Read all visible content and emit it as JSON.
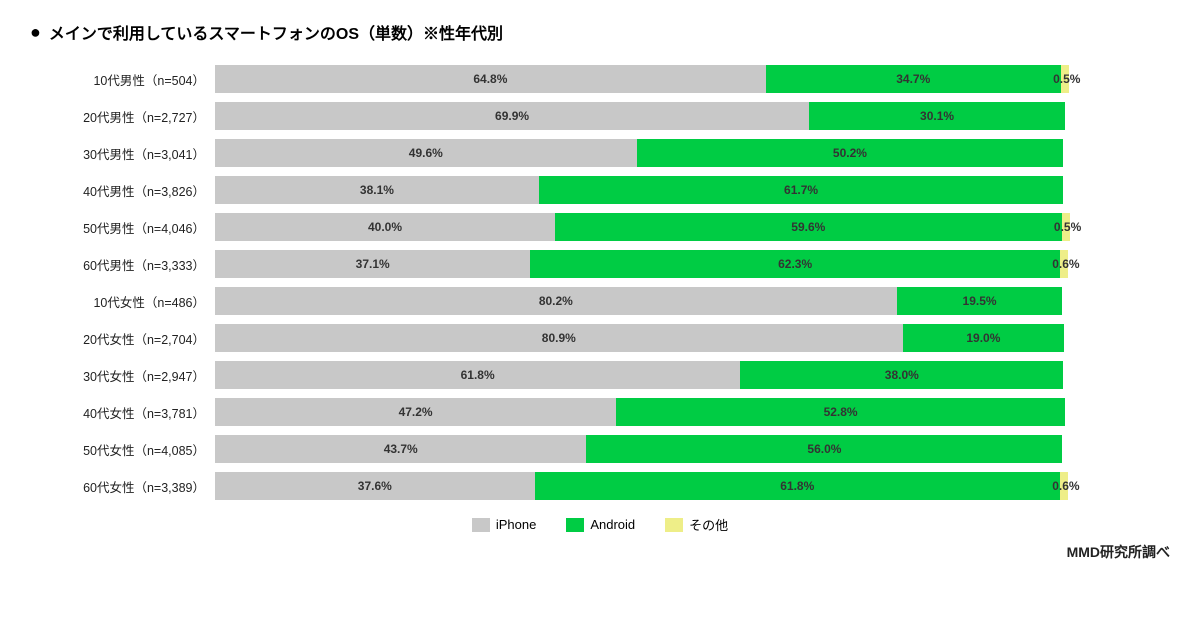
{
  "title": "メインで利用しているスマートフォンのOS（単数）※性年代別",
  "bullet": "●",
  "chart": {
    "bars": [
      {
        "label": "10代男性（n=504）",
        "iphone": 64.8,
        "android": 34.7,
        "other": 0.5
      },
      {
        "label": "20代男性（n=2,727）",
        "iphone": 69.9,
        "android": 30.1,
        "other": 0
      },
      {
        "label": "30代男性（n=3,041）",
        "iphone": 49.6,
        "android": 50.2,
        "other": 0
      },
      {
        "label": "40代男性（n=3,826）",
        "iphone": 38.1,
        "android": 61.7,
        "other": 0
      },
      {
        "label": "50代男性（n=4,046）",
        "iphone": 40.0,
        "android": 59.6,
        "other": 0.5
      },
      {
        "label": "60代男性（n=3,333）",
        "iphone": 37.1,
        "android": 62.3,
        "other": 0.6
      },
      {
        "label": "10代女性（n=486）",
        "iphone": 80.2,
        "android": 19.5,
        "other": 0
      },
      {
        "label": "20代女性（n=2,704）",
        "iphone": 80.9,
        "android": 19.0,
        "other": 0
      },
      {
        "label": "30代女性（n=2,947）",
        "iphone": 61.8,
        "android": 38.0,
        "other": 0
      },
      {
        "label": "40代女性（n=3,781）",
        "iphone": 47.2,
        "android": 52.8,
        "other": 0
      },
      {
        "label": "50代女性（n=4,085）",
        "iphone": 43.7,
        "android": 56.0,
        "other": 0
      },
      {
        "label": "60代女性（n=3,389）",
        "iphone": 37.6,
        "android": 61.8,
        "other": 0.6
      }
    ]
  },
  "legend": {
    "iphone_label": "iPhone",
    "android_label": "Android",
    "other_label": "その他"
  },
  "footer": "MMD研究所調べ"
}
